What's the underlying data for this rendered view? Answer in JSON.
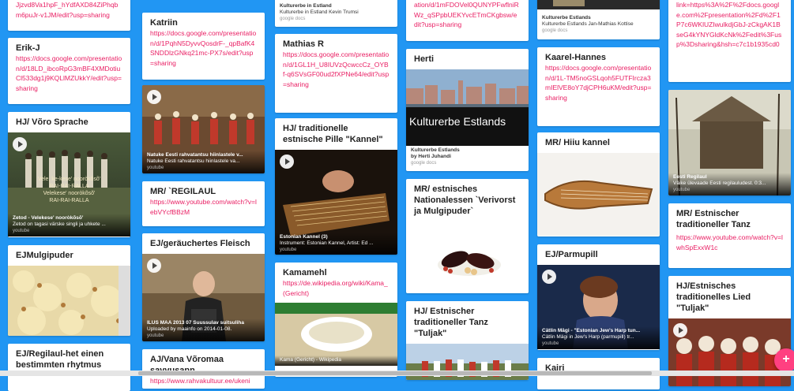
{
  "col1": {
    "top_link": "Jjzvd8Va1hpF_hYdfAXD84ZiPhqbm6puJr-v1JM/edit?usp=sharing",
    "erik": {
      "title": "Erik-J",
      "link": "https://docs.google.com/presentation/d/18LD_ibcoRpG3mBF4XMDotiuCl533dg1j9KQLlMZUkkY/edit?usp=sharing"
    },
    "voro": {
      "title": "HJ/ Võro Sprache",
      "caption1": "Zetod - Velekese' nooròkõsõ'",
      "caption2": "Zetod on tagasi värske singli ja uhkete ...",
      "source": "youtube",
      "overlay1": "Vele, ke-kese' nooròkõsõ'",
      "overlay2": "RAI-RAI-RALLA",
      "overlay3": "Velekese' nooròkõsõ'",
      "overlay4": "RAI-RAI-RALLA"
    },
    "mulgi": {
      "title": "EJMulgipuder"
    },
    "regilaul": {
      "title": "EJ/Regilaul-het einen bestimmten rhytmus"
    }
  },
  "col2": {
    "katriin": {
      "title": "Katriin",
      "link": "https://docs.google.com/presentation/d/1PqhN5DyvvQosdrF-_qpBafK4SNDDlzGNkq21mc-PX7s/edit?usp=sharing"
    },
    "natuke": {
      "caption1": "Natuke Eesti rahvatantsu hiinlastele v...",
      "caption2": "Natuke Eesti rahvatantsu hiinlastele va...",
      "source": "youtube"
    },
    "mr_regilaul": {
      "title": "MR/ `REGILAUL",
      "link": "https://www.youtube.com/watch?v=lebVYcfBBzM"
    },
    "fleisch": {
      "title": "EJ/geräuchertes Fleisch",
      "caption1": "ILUS MAA 2013 07 Suussulav suitsuliha",
      "caption2": "Uploaded by maainfo on 2014-01-08.",
      "source": "youtube"
    },
    "vana": {
      "title": "AJ/Vana Võromaa savvusann",
      "link": "https://www.rahvakultuur.ee/ukeni"
    }
  },
  "col3": {
    "top": {
      "line1": "Kulturerbe in Estland",
      "line2": "Kulturerbe in Estland Kevin Trumsi",
      "source": "google docs"
    },
    "mathias": {
      "title": "Mathias R",
      "link": "https://docs.google.com/presentation/d/1GL1H_U8IUVzQcwccCz_OYBf-q6SVsGF00ud2fXPNe64/edit?usp=sharing"
    },
    "pille": {
      "title": "HJ/ traditionelle estnische Pille \"Kannel\"",
      "caption1": "Estonian Kannel (3)",
      "caption2": "Instrument: Estonian Kannel, Artist: Ed ...",
      "source": "youtube"
    },
    "kama": {
      "title": "Kamamehl",
      "link": "https://de.wikipedia.org/wiki/Kama_(Gericht)",
      "caption": "Kama (Gericht) - Wikipedia"
    }
  },
  "col4": {
    "top_link": "ation/d/1mFDOVel0QUNYPFwflniRWz_qSPpbUEKYvcETmCKgbsw/edit?usp=sharing",
    "herti": {
      "title": "Herti",
      "banner": "Kulturerbe Estlands",
      "caption1": "Kulturerbe Estlands",
      "caption2": "by Herti Juhandi",
      "source": "google docs"
    },
    "verivorst": {
      "title": "MR/ estnisches Nationalessen `Verivorst ja Mulgipuder`"
    },
    "tuljak": {
      "title": "HJ/ Estnischer traditioneller Tanz \"Tuljak\""
    }
  },
  "col5": {
    "top": {
      "line1": "Kulturerbe Estlands",
      "line2": "Kulturerbe Estlands Jan-Mathias Kottise",
      "source": "google docs"
    },
    "kaarel": {
      "title": "Kaarel-Hannes",
      "link": "https://docs.google.com/presentation/d/1L-TM5noGSLqoh5FUTFIrcza3mIElVE8oY7djCPH6uKM/edit?usp=sharing"
    },
    "hiiu": {
      "title": "MR/ Hiiu kannel"
    },
    "parmupill": {
      "title": "EJ/Parmupill",
      "caption1": "Cätlin Mägi - \"Estonian Jew's Harp tun...",
      "caption2": "Cätlin Mägi in Jew's Harp (parmupill) tr...",
      "source": "youtube"
    },
    "kairi": {
      "title": "Kairi"
    }
  },
  "col6": {
    "top_link": "link=https%3A%2F%2Fdocs.google.com%2Fpresentation%2Fd%2F1P7c6WKlUZIwulkdjGbJ-zCkgAK1BseG4kYNYGldKcNk%2Fedit%3Fusp%3Dsharing&hsh=c7c1b1935cd0",
    "regilaul": {
      "caption1": "Eesti Regilaul",
      "caption2": "Väike ülevaade Eesti regilauludest. 0:3...",
      "source": "youtube"
    },
    "mr_tanz": {
      "title": "MR/ Estnischer traditioneller Tanz",
      "link": "https://www.youtube.com/watch?v=lwhSpExxW1c"
    },
    "hj_tanz": {
      "title": "HJ/Estnisches traditionelles Lied \"Tuljak\""
    }
  },
  "fab": {
    "label": "+"
  },
  "colors": {
    "background": "#2196f3",
    "link": "#e91e63",
    "fab": "#ff4081"
  }
}
